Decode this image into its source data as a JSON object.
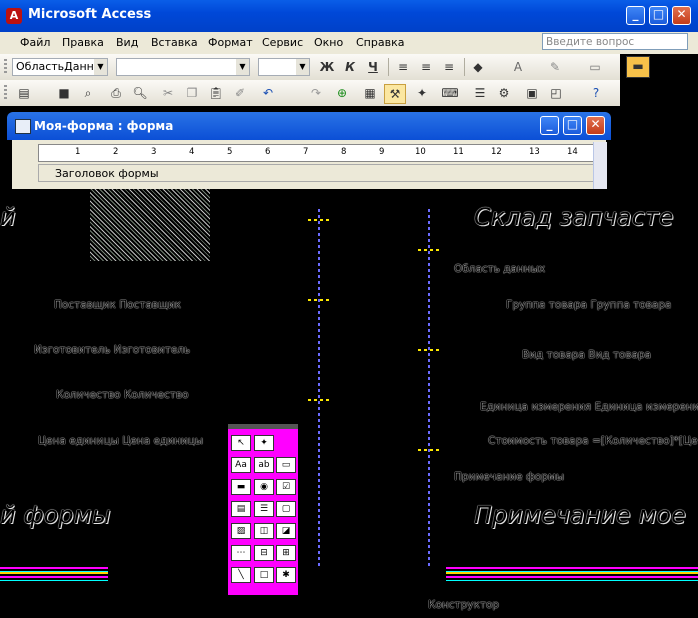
{
  "window": {
    "app_icon": "access-key-icon",
    "title": "Microsoft Access",
    "buttons": {
      "minimize": "_",
      "maximize": "□",
      "close": "✕"
    }
  },
  "menu": {
    "items": [
      "Файл",
      "Правка",
      "Вид",
      "Вставка",
      "Формат",
      "Сервис",
      "Окно",
      "Справка"
    ],
    "help_placeholder": "Введите вопрос"
  },
  "toolbar_format": {
    "object_combo": "ОбластьДанны",
    "bold": "Ж",
    "italic": "К",
    "underline": "Ч"
  },
  "form_window": {
    "title": "Моя-форма : форма",
    "ruler_numbers": [
      "1",
      "2",
      "3",
      "4",
      "5",
      "6",
      "7",
      "8",
      "9",
      "10",
      "11",
      "12",
      "13",
      "14"
    ],
    "header_section": "Заголовок формы"
  },
  "canvas": {
    "title_left": "й",
    "title_right": "Склад запчасте",
    "detail_section": "Область данных",
    "fields_left": [
      {
        "label": "Поставщик",
        "value": "Поставщик"
      },
      {
        "label": "Изготовитель",
        "value": "Изготовитель"
      },
      {
        "label": "Количество",
        "value": "Количество"
      },
      {
        "label": "Цена единицы",
        "value": "Цена единицы"
      }
    ],
    "fields_right": [
      {
        "label": "Группа товара",
        "value": "Группа товара"
      },
      {
        "label": "Вид товара",
        "value": "Вид товара"
      },
      {
        "label": "Единица измерения",
        "value": "Единица измерения"
      },
      {
        "label": "Стоимость товара",
        "value": "=[Количество]*[Це"
      }
    ],
    "footer_section": "Примечание формы",
    "footer_left": "й формы",
    "footer_right": "Примечание мое",
    "constructor_label": "Конструктор"
  }
}
